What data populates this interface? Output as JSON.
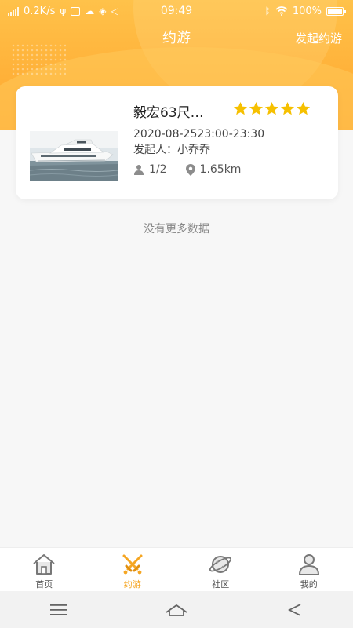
{
  "status_bar": {
    "net_speed": "0.2K/s",
    "time": "09:49",
    "battery": "100%"
  },
  "header": {
    "title": "约游",
    "action_label": "发起约游"
  },
  "trips": [
    {
      "title": "毅宏63尺…",
      "rating": 5,
      "datetime": "2020-08-2523:00-23:30",
      "host": "发起人：小乔乔",
      "participants": "1/2",
      "distance": "1.65km",
      "image": "yacht-photo"
    }
  ],
  "empty_hint": "没有更多数据",
  "tab_bar": {
    "items": [
      {
        "label": "首页",
        "icon": "home-icon",
        "active": false
      },
      {
        "label": "约游",
        "icon": "swords-icon",
        "active": true
      },
      {
        "label": "社区",
        "icon": "planet-icon",
        "active": false
      },
      {
        "label": "我的",
        "icon": "person-icon",
        "active": false
      }
    ]
  },
  "colors": {
    "accent": "#f5a623",
    "header": "#ffb23a",
    "star": "#f6c000"
  }
}
